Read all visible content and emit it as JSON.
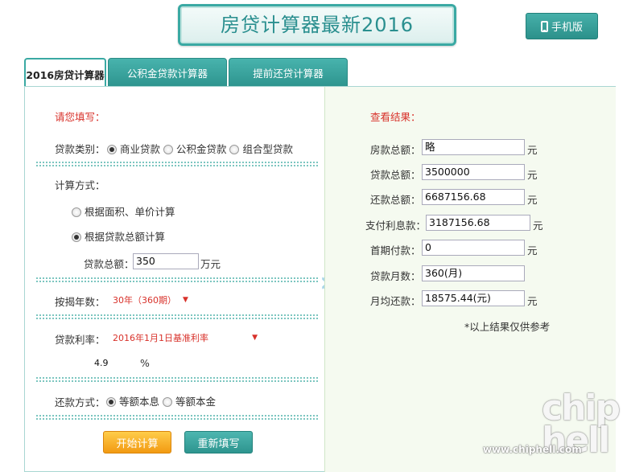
{
  "header": {
    "title": "房贷计算器最新2016",
    "mobile_button": "手机版",
    "mobile_icon": "phone-icon"
  },
  "tabs": [
    {
      "label": "2016房贷计算器",
      "active": true
    },
    {
      "label": "公积金贷款计算器",
      "active": false
    },
    {
      "label": "提前还贷计算器",
      "active": false
    }
  ],
  "form": {
    "heading": "请您填写：",
    "loan_type_label": "贷款类别：",
    "loan_types": [
      "商业贷款",
      "公积金贷款",
      "组合型贷款"
    ],
    "loan_type_selected": "商业贷款",
    "calc_method_label": "计算方式：",
    "calc_methods": [
      "根据面积、单价计算",
      "根据贷款总额计算"
    ],
    "calc_method_selected": "根据贷款总额计算",
    "loan_amount_label": "贷款总额：",
    "loan_amount_value": "350",
    "loan_amount_unit": "万元",
    "years_label": "按揭年数：",
    "years_value": "30年（360期）",
    "rate_label": "贷款利率：",
    "rate_option": "2016年1月1日基准利率",
    "rate_value": "4.9",
    "rate_unit": "%",
    "repay_label": "还款方式：",
    "repay_methods": [
      "等额本息",
      "等额本金"
    ],
    "repay_selected": "等额本息",
    "start_button": "开始计算",
    "reset_button": "重新填写"
  },
  "results": {
    "heading": "查看结果：",
    "rows": [
      {
        "label": "房款总额：",
        "value": "略",
        "unit": "元"
      },
      {
        "label": "贷款总额：",
        "value": "3500000",
        "unit": "元"
      },
      {
        "label": "还款总额：",
        "value": "6687156.68",
        "unit": "元"
      },
      {
        "label": "支付利息款：",
        "value": "3187156.68",
        "unit": "元"
      },
      {
        "label": "首期付款：",
        "value": "0",
        "unit": "元"
      },
      {
        "label": "贷款月数：",
        "value": "360(月)",
        "unit": ""
      },
      {
        "label": "月均还款：",
        "value": "18575.44(元)",
        "unit": "元"
      }
    ],
    "note": "*以上结果仅供参考"
  },
  "watermark": {
    "logo_text": "chip hell",
    "url": "www.chiphell.com"
  }
}
